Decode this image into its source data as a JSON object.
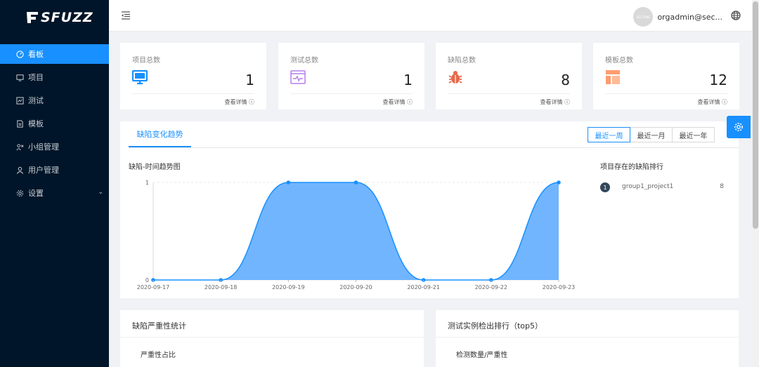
{
  "brand": {
    "name": "SFUZZ"
  },
  "sidebar": {
    "items": [
      {
        "label": "看板",
        "icon": "dashboard-icon"
      },
      {
        "label": "项目",
        "icon": "monitor-icon"
      },
      {
        "label": "测试",
        "icon": "test-icon"
      },
      {
        "label": "模板",
        "icon": "file-icon"
      },
      {
        "label": "小组管理",
        "icon": "team-icon"
      },
      {
        "label": "用户管理",
        "icon": "user-icon"
      },
      {
        "label": "设置",
        "icon": "gear-icon"
      }
    ]
  },
  "header": {
    "username": "orgadmin@sec...",
    "avatar_text": "SECZONE"
  },
  "cards": [
    {
      "title": "项目总数",
      "value": "1",
      "detail": "查看详情",
      "icon": "monitor-icon",
      "color": "#1890ff"
    },
    {
      "title": "测试总数",
      "value": "1",
      "detail": "查看详情",
      "icon": "test-window-icon",
      "color": "#b37feb"
    },
    {
      "title": "缺陷总数",
      "value": "8",
      "detail": "查看详情",
      "icon": "bug-icon",
      "color": "#e8684a"
    },
    {
      "title": "模板总数",
      "value": "12",
      "detail": "查看详情",
      "icon": "template-icon",
      "color": "#ff9c6e"
    }
  ],
  "trend": {
    "tab": "缺陷变化趋势",
    "ranges": [
      "最近一周",
      "最近一月",
      "最近一年"
    ],
    "chart_title": "缺陷-时间趋势图",
    "rank_title": "项目存在的缺陷排行",
    "ranking": [
      {
        "rank": "1",
        "name": "group1_project1",
        "count": "8"
      }
    ]
  },
  "chart_data": {
    "type": "area",
    "title": "缺陷-时间趋势图",
    "x": [
      "2020-09-17",
      "2020-09-18",
      "2020-09-19",
      "2020-09-20",
      "2020-09-21",
      "2020-09-22",
      "2020-09-23"
    ],
    "y": [
      0,
      0,
      1,
      1,
      0,
      0,
      1
    ],
    "yticks": [
      "0",
      "1"
    ],
    "ylim": [
      0,
      1
    ],
    "color": "#1890ff",
    "fill": "#69b1ff"
  },
  "panels": {
    "severity": {
      "title": "缺陷严重性统计",
      "subtitle": "严重性占比"
    },
    "top5": {
      "title": "测试实例检出排行（top5）",
      "subtitle": "检测数量/严重性"
    }
  },
  "colors": {
    "sidebar": "#001529",
    "accent": "#1890ff"
  }
}
